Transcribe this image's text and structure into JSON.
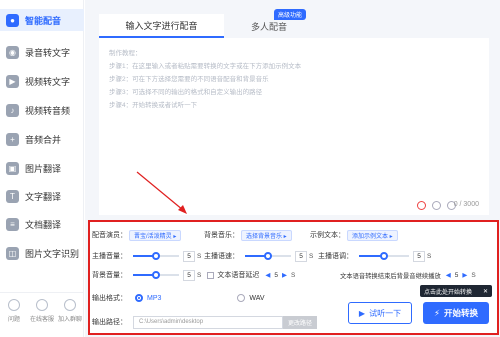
{
  "sidebar": {
    "items": [
      {
        "label": "智能配音",
        "icon": "microphone-icon",
        "active": true
      },
      {
        "label": "录音转文字",
        "icon": "recording-icon"
      },
      {
        "label": "视频转文字",
        "icon": "video-text-icon"
      },
      {
        "label": "视频转音频",
        "icon": "video-audio-icon"
      },
      {
        "label": "音频合并",
        "icon": "audio-merge-icon"
      },
      {
        "label": "图片翻译",
        "icon": "image-translate-icon"
      },
      {
        "label": "文字翻译",
        "icon": "text-translate-icon"
      },
      {
        "label": "文档翻译",
        "icon": "doc-translate-icon"
      },
      {
        "label": "图片文字识别",
        "icon": "ocr-icon"
      }
    ],
    "bottom": [
      {
        "label": "问题",
        "icon": "question-icon"
      },
      {
        "label": "在线客服",
        "icon": "service-icon"
      },
      {
        "label": "加入群聊",
        "icon": "group-icon"
      }
    ]
  },
  "tabs": {
    "tab1": "输入文字进行配音",
    "tab2": "多人配音",
    "badge": "高级功能"
  },
  "editor": {
    "lines": [
      "制作教程：",
      "步骤1：在这里输入或者粘贴需要转换的文字或在下方添加示例文本",
      "步骤2：可在下方选择您需要的不同语音配音和背景音乐",
      "步骤3：可选择不同的输出的格式和自定义输出的路径",
      "步骤4：开始转换或者试听一下"
    ],
    "count": "0 / 3000"
  },
  "settings": {
    "voice_label": "配音演员：",
    "voice_value": "晋宝/活泼精灵 ▸",
    "bgm_label": "背景音乐：",
    "bgm_value": "选择背景音乐 ▸",
    "sample_label": "示例文本：",
    "sample_value": "添加示例文本 ▸",
    "vol_label": "主播音量：",
    "vol_value": "5",
    "speed_label": "主播语速：",
    "speed_value": "5",
    "pitch_label": "主播语调：",
    "pitch_value": "5",
    "bgvol_label": "背景音量：",
    "bgvol_value": "5",
    "delay_label": "文本语音延迟",
    "delay_prefix": "◀",
    "delay_value": "5",
    "delay_suffix": "▶",
    "delay_unit": "S",
    "loop_label": "文本语音转换结束后背景音继续播放",
    "loop_value": "5",
    "loop_unit": "S",
    "unit_s": "S",
    "format_label": "输出格式：",
    "fmt_mp3": "MP3",
    "fmt_wav": "WAV",
    "path_label": "输出路径：",
    "path_value": "C:\\Users\\admin\\desktop",
    "change_path": "更改路径",
    "listen": "试听一下",
    "start": "开始转换",
    "tip": "点击此处开始转换",
    "tip_close": "✕"
  },
  "colors": {
    "accent": "#2f6bff",
    "highlight": "#e02020"
  }
}
